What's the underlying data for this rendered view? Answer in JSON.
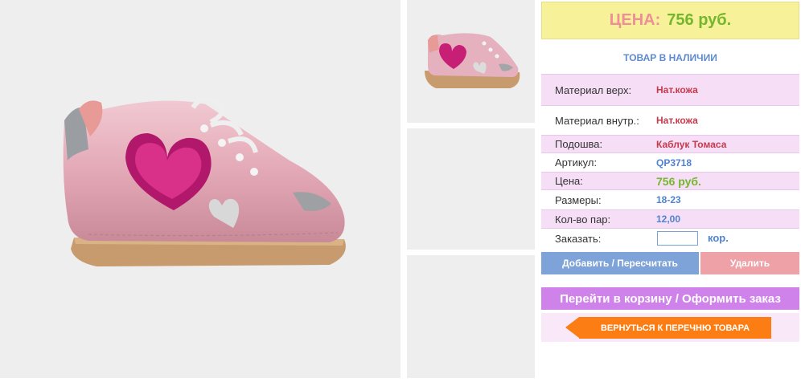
{
  "images": {
    "main": "shoe-photo",
    "thumbnails": [
      "shoe-thumbnail",
      "empty-thumbnail",
      "empty-thumbnail"
    ]
  },
  "price": {
    "label": "ЦЕНА:",
    "value": "756 руб."
  },
  "stock_status": "ТОВАР В НАЛИЧИИ",
  "specs": [
    {
      "key": "Материал верх:",
      "value": "Нат.кожа"
    },
    {
      "key": "Материал внутр.:",
      "value": "Нат.кожа"
    },
    {
      "key": "Подошва:",
      "value": "Каблук Томаса"
    },
    {
      "key": "Артикул:",
      "value": "QP3718"
    },
    {
      "key": "Цена:",
      "value": "756 руб."
    },
    {
      "key": "Размеры:",
      "value": "18-23"
    },
    {
      "key": "Кол-во пар:",
      "value": "12,00"
    }
  ],
  "order": {
    "label": "Заказать:",
    "value": "",
    "unit": "кор."
  },
  "buttons": {
    "add": "Добавить / Пересчитать",
    "delete": "Удалить",
    "cart": "Перейти в корзину / Оформить заказ",
    "back": "ВЕРНУТЬСЯ К ПЕРЕЧНЮ ТОВАРА"
  },
  "colors": {
    "price_label": "#ee8f97",
    "price_value": "#74b62d",
    "accent_blue": "#4f83cf",
    "accent_red": "#c63a4c",
    "cart_button": "#cf82ea",
    "back_button": "#fb7d14"
  }
}
